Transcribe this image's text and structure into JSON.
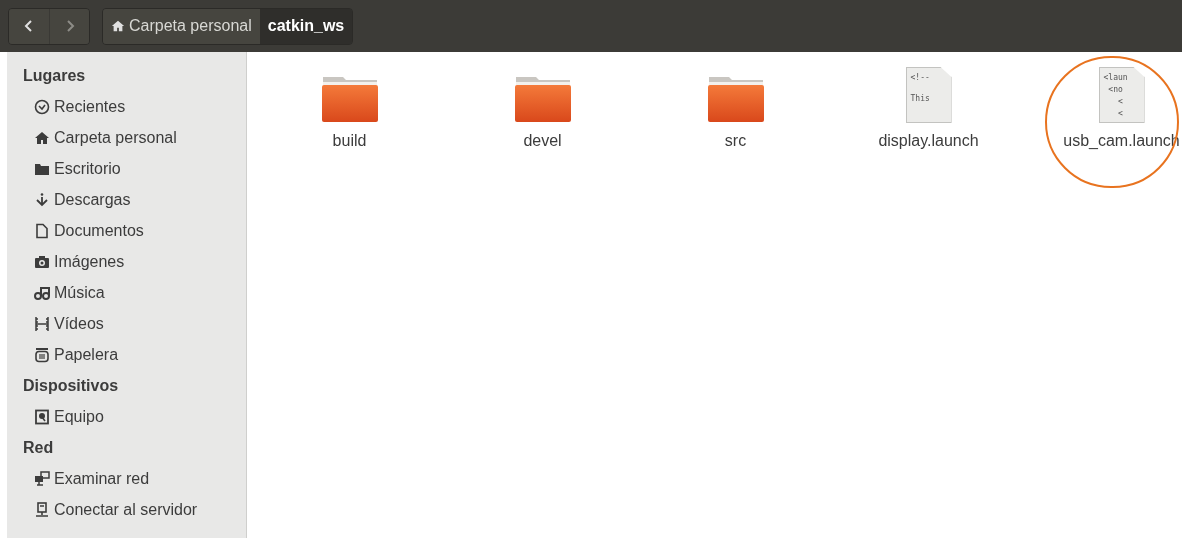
{
  "breadcrumb": [
    {
      "label": "Carpeta personal",
      "kind": "home",
      "selected": false
    },
    {
      "label": "catkin_ws",
      "kind": "folder",
      "selected": true
    }
  ],
  "sidebar": [
    {
      "heading": "Lugares",
      "items": [
        {
          "label": "Recientes",
          "kind": "clock"
        },
        {
          "label": "Carpeta personal",
          "kind": "home"
        },
        {
          "label": "Escritorio",
          "kind": "folder"
        },
        {
          "label": "Descargas",
          "kind": "download"
        },
        {
          "label": "Documentos",
          "kind": "document"
        },
        {
          "label": "Imágenes",
          "kind": "camera"
        },
        {
          "label": "Música",
          "kind": "music"
        },
        {
          "label": "Vídeos",
          "kind": "film"
        },
        {
          "label": "Papelera",
          "kind": "trash"
        }
      ]
    },
    {
      "heading": "Dispositivos",
      "items": [
        {
          "label": "Equipo",
          "kind": "drive"
        }
      ]
    },
    {
      "heading": "Red",
      "items": [
        {
          "label": "Examinar red",
          "kind": "network"
        },
        {
          "label": "Conectar al servidor",
          "kind": "server"
        }
      ]
    }
  ],
  "files": [
    {
      "name": "build",
      "kind": "folder"
    },
    {
      "name": "devel",
      "kind": "folder"
    },
    {
      "name": "src",
      "kind": "folder"
    },
    {
      "name": "display.launch",
      "kind": "text",
      "preview": [
        "<!--",
        "This"
      ],
      "circled": false
    },
    {
      "name": "usb_cam.launch",
      "kind": "text",
      "preview": [
        "<laun",
        " <no",
        "   <",
        "   <"
      ],
      "circled": true
    }
  ]
}
